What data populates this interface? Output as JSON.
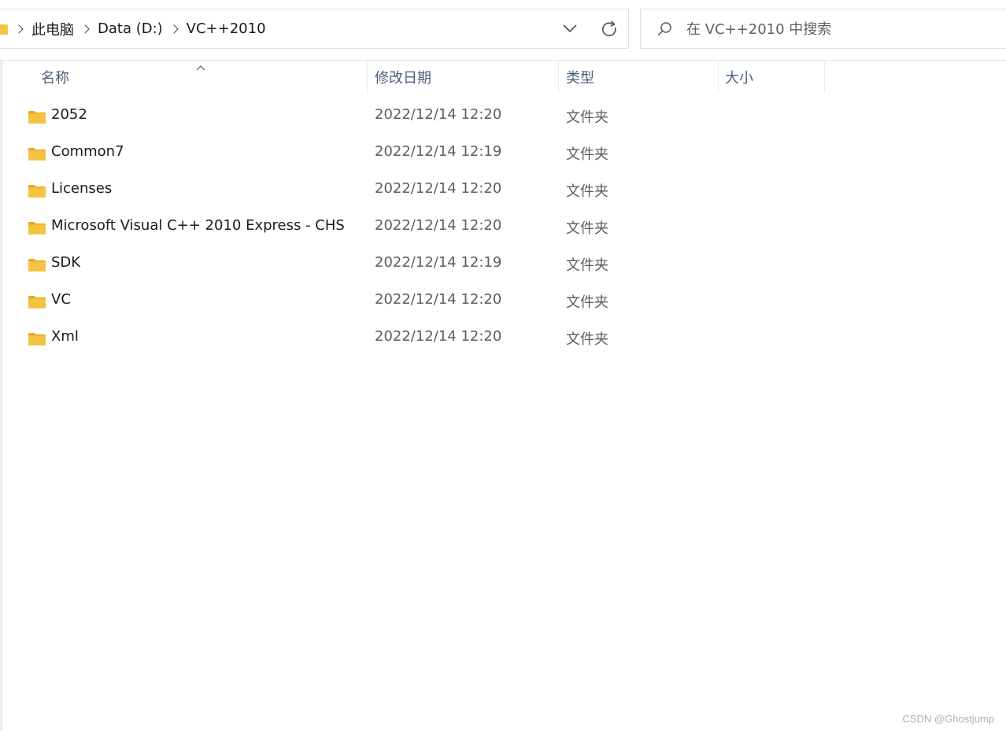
{
  "breadcrumbs": [
    "此电脑",
    "Data (D:)",
    "VC++2010"
  ],
  "search": {
    "placeholder": "在 VC++2010 中搜索"
  },
  "columns": {
    "name": "名称",
    "date": "修改日期",
    "type": "类型",
    "size": "大小"
  },
  "files": [
    {
      "name": "2052",
      "date": "2022/12/14 12:20",
      "type": "文件夹"
    },
    {
      "name": "Common7",
      "date": "2022/12/14 12:19",
      "type": "文件夹"
    },
    {
      "name": "Licenses",
      "date": "2022/12/14 12:20",
      "type": "文件夹"
    },
    {
      "name": "Microsoft Visual C++ 2010 Express - CHS",
      "date": "2022/12/14 12:20",
      "type": "文件夹"
    },
    {
      "name": "SDK",
      "date": "2022/12/14 12:19",
      "type": "文件夹"
    },
    {
      "name": "VC",
      "date": "2022/12/14 12:20",
      "type": "文件夹"
    },
    {
      "name": "Xml",
      "date": "2022/12/14 12:20",
      "type": "文件夹"
    }
  ],
  "icons": {
    "folder": "folder-icon",
    "dropdown": "chevron-down-icon",
    "refresh": "refresh-icon",
    "search": "search-icon",
    "sort": "sort-ascending-icon"
  },
  "colors": {
    "folder": "#f5c342",
    "header_text": "#4c607a"
  },
  "watermark": "CSDN @Ghostjump"
}
